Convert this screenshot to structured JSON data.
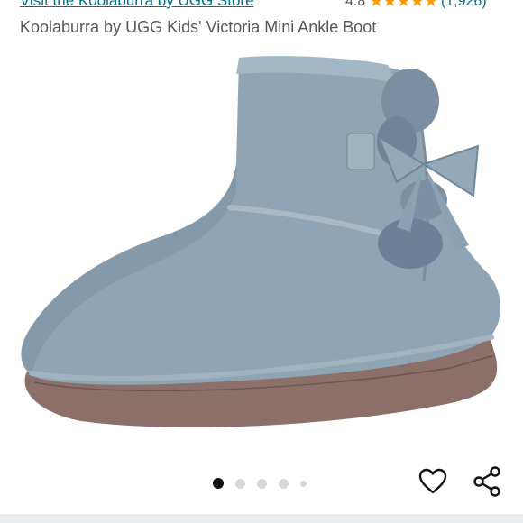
{
  "header": {
    "store_link": "Visit the Koolaburra by UGG Store",
    "rating_value": "4.8",
    "stars": "★★★★★",
    "review_count": "(1,926)"
  },
  "product": {
    "title": "Koolaburra by UGG Kids' Victoria Mini Ankle Boot",
    "color": "#8a9fae"
  },
  "gallery": {
    "image_count": 5,
    "active_index": 0
  },
  "actions": {
    "wishlist_icon": "heart-outline-icon",
    "share_icon": "share-icon"
  }
}
